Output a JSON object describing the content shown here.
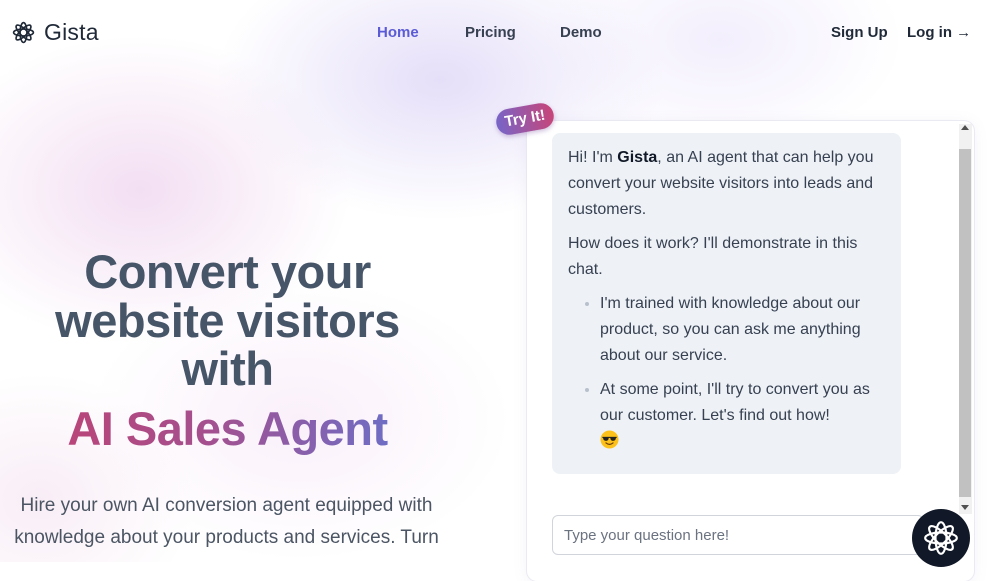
{
  "brand": {
    "name": "Gista",
    "icon": "flower-logo-icon"
  },
  "nav": {
    "home": "Home",
    "pricing": "Pricing",
    "demo": "Demo"
  },
  "auth": {
    "signup": "Sign Up",
    "login": "Log in →"
  },
  "hero": {
    "line1": "Convert your",
    "line2": "website visitors",
    "line3": "with",
    "gradient_line": "AI Sales Agent",
    "sub_line1": "Hire your own AI conversion agent equipped with",
    "sub_line2": "knowledge about your products and services. Turn"
  },
  "badge": {
    "label": "Try It!"
  },
  "chat": {
    "msg_intro_pre": "Hi! I'm ",
    "msg_intro_name": "Gista",
    "msg_intro_post": ", an AI agent that can help you convert your website visitors into leads and customers.",
    "msg_how": "How does it work? I'll demonstrate in this chat.",
    "bullet1": "I'm trained with knowledge about our product, so you can ask me anything about our service.",
    "bullet2": "At some point, I'll try to convert you as our customer. Let's find out how!",
    "bullet2_emoji": "sunglasses-emoji-icon",
    "input_placeholder": "Type your question here!"
  },
  "colors": {
    "accent": "#5b5bd6",
    "gradient_start": "#c2416f",
    "gradient_end": "#5b78d8",
    "badge_start": "#7765c8",
    "badge_end": "#c84578"
  }
}
